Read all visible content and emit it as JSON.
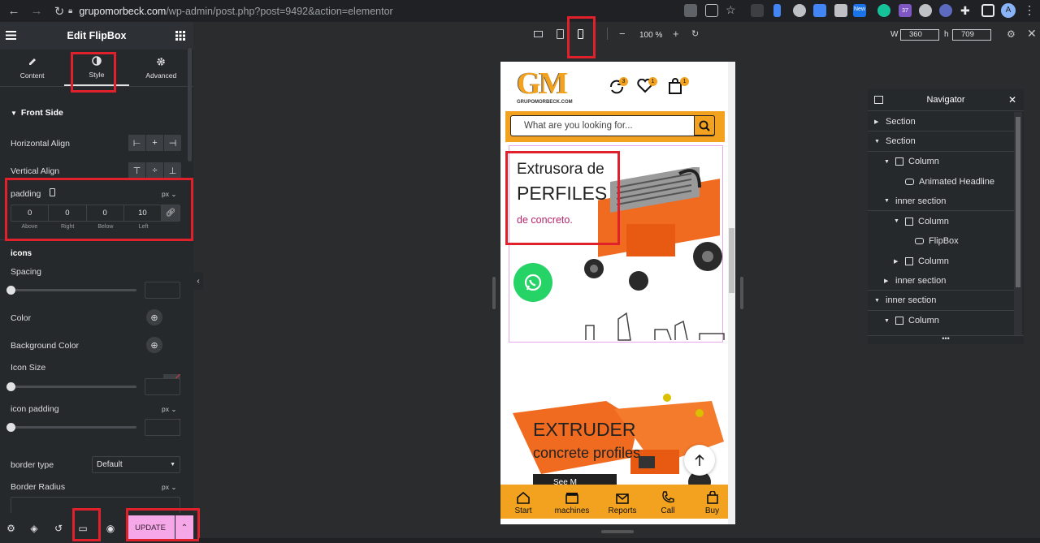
{
  "browser": {
    "url_host": "grupomorbeck.com",
    "url_path": "/wp-admin/post.php?post=9492&action=elementor",
    "profile_initial": "A",
    "extension_badge_new": "New",
    "extension_badge_count": "37"
  },
  "editor": {
    "title": "Edit FlipBox",
    "tabs": [
      {
        "label": "Content",
        "icon": "pencil-icon"
      },
      {
        "label": "Style",
        "icon": "contrast-icon"
      },
      {
        "label": "Advanced",
        "icon": "gear-icon"
      }
    ],
    "section_title": "Front Side",
    "horizontal_align_label": "Horizontal Align",
    "vertical_align_label": "Vertical Align",
    "padding": {
      "label": "padding",
      "unit": "px",
      "values": [
        "0",
        "0",
        "0",
        "10"
      ],
      "sublabels": [
        "Above",
        "Right",
        "Below",
        "Left"
      ]
    },
    "icons_heading": "icons",
    "spacing_label": "Spacing",
    "color_label": "Color",
    "bg_color_label": "Background Color",
    "icon_size_label": "Icon Size",
    "icon_padding_label": "icon padding",
    "icon_padding_unit": "px",
    "border_type_label": "border type",
    "border_type_value": "Default",
    "border_radius_label": "Border Radius",
    "border_radius_unit": "px"
  },
  "bottom": {
    "update_label": "UPDATE"
  },
  "toolbar": {
    "zoom": "100 %",
    "width_label": "W",
    "width_value": "360",
    "height_label": "h",
    "height_value": "709"
  },
  "site": {
    "logo_text": "GM",
    "logo_sub": "GRUPOMORBECK.COM",
    "badge_1": "3",
    "badge_2": "1",
    "badge_3": "1",
    "search_placeholder": "What are you looking for...",
    "hero_line1": "Extrusora de",
    "hero_line2": "PERFILES",
    "hero_line3": "de concreto.",
    "banner2_line1": "EXTRUDER",
    "banner2_line2": "concrete profiles",
    "banner2_button": "See M",
    "bottom_nav": [
      "Start",
      "machines",
      "Reports",
      "Call",
      "Buy"
    ]
  },
  "navigator": {
    "title": "Navigator",
    "items": [
      {
        "label": "Section",
        "level": 0,
        "arrow": "right"
      },
      {
        "label": "Section",
        "level": 0,
        "arrow": "down"
      },
      {
        "label": "Column",
        "level": 1,
        "arrow": "down"
      },
      {
        "label": "Animated Headline",
        "level": 2,
        "arrow": "none"
      },
      {
        "label": "inner section",
        "level": 1,
        "arrow": "down"
      },
      {
        "label": "Column",
        "level": 2,
        "arrow": "down"
      },
      {
        "label": "FlipBox",
        "level": 3,
        "arrow": "none"
      },
      {
        "label": "Column",
        "level": 2,
        "arrow": "right"
      },
      {
        "label": "inner section",
        "level": 1,
        "arrow": "right"
      },
      {
        "label": "inner section",
        "level": 0,
        "arrow": "down"
      },
      {
        "label": "Column",
        "level": 1,
        "arrow": "down"
      }
    ]
  },
  "colors": {
    "accent_yellow": "#f2a21e",
    "machine_orange": "#f06a1f",
    "highlight_red": "#e0202b",
    "update_pink": "#f5a7e8",
    "whatsapp_green": "#25d366",
    "hero_pink_text": "#b5256b"
  }
}
